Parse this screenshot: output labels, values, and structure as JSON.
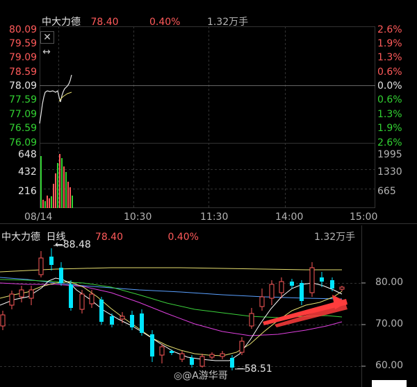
{
  "intraday": {
    "stock_name": "中大力德",
    "price": "78.40",
    "change_pct": "0.40%",
    "volume": "1.32万手",
    "price_axis": [
      "80.09",
      "79.59",
      "79.09",
      "78.59",
      "78.09",
      "77.59",
      "77.09",
      "76.59",
      "76.09"
    ],
    "pct_axis": [
      "2.6%",
      "1.9%",
      "1.3%",
      "0.6%",
      "0.0%",
      "0.6%",
      "1.3%",
      "1.9%",
      "2.6%"
    ],
    "vol_axis_left": [
      "648",
      "432",
      "216"
    ],
    "vol_axis_right": [
      "1995",
      "1330",
      "665"
    ],
    "time_axis": [
      "08/14",
      "10:30",
      "11:30",
      "14:00",
      "15:00"
    ],
    "close_icon": "close-icon",
    "resize_icon": "horizontal-resize-icon"
  },
  "daily": {
    "stock_name": "中大力德",
    "period": "日线",
    "price": "78.40",
    "change_pct": "0.40%",
    "volume": "1.32万手",
    "high_marker": "88.48",
    "low_marker": "58.51",
    "price_axis": [
      "80.00",
      "70.00",
      "60.00"
    ]
  },
  "watermark": "@A游华哥",
  "colors": {
    "up": "#ff5a5a",
    "down": "#00e5ff",
    "flat_green": "#32d232",
    "ma_white": "#ffffff",
    "ma_yellow": "#e8e070",
    "ma_green": "#3cd23c",
    "ma_magenta": "#e040e0",
    "ma_blue": "#5aa0ff",
    "arrow": "#ff3c3c"
  }
}
